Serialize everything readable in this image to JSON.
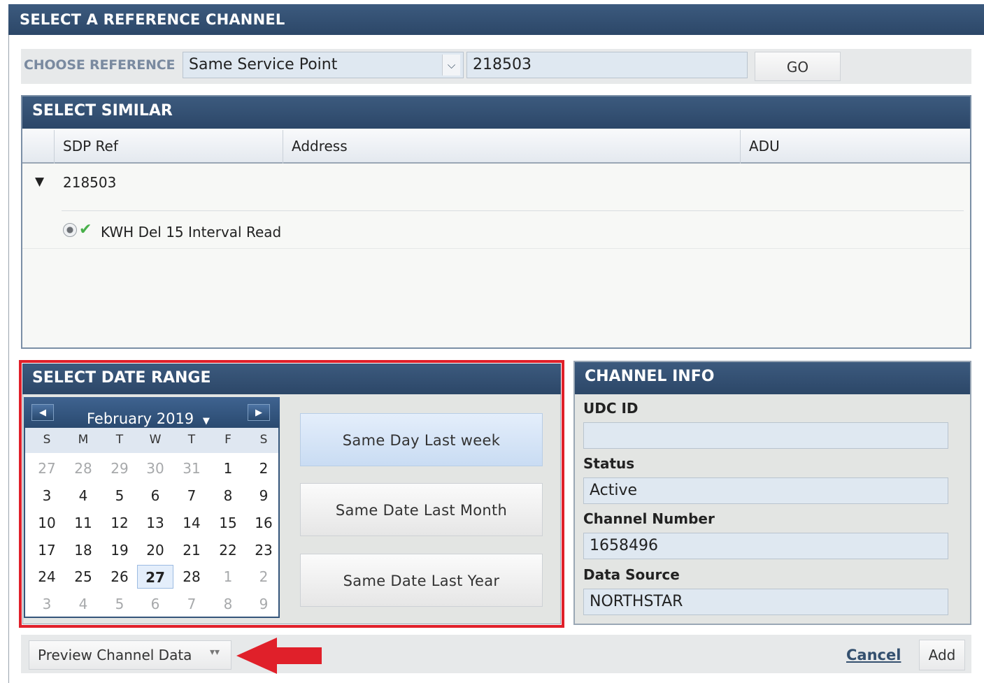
{
  "dialog": {
    "title": "SELECT A REFERENCE CHANNEL"
  },
  "choose": {
    "label": "CHOOSE REFERENCE",
    "selected": "Same Service Point",
    "reference_value": "218503",
    "go_label": "GO"
  },
  "similar": {
    "title": "SELECT SIMILAR",
    "columns": [
      "SDP Ref",
      "Address",
      "ADU"
    ],
    "sdp_ref": "218503",
    "channel_label": "KWH Del 15 Interval Read"
  },
  "date_range": {
    "title": "SELECT DATE RANGE",
    "month_label": "February 2019",
    "dow": [
      "S",
      "M",
      "T",
      "W",
      "T",
      "F",
      "S"
    ],
    "weeks": [
      [
        "27",
        "28",
        "29",
        "30",
        "31",
        "1",
        "2"
      ],
      [
        "3",
        "4",
        "5",
        "6",
        "7",
        "8",
        "9"
      ],
      [
        "10",
        "11",
        "12",
        "13",
        "14",
        "15",
        "16"
      ],
      [
        "17",
        "18",
        "19",
        "20",
        "21",
        "22",
        "23"
      ],
      [
        "24",
        "25",
        "26",
        "27",
        "28",
        "1",
        "2"
      ],
      [
        "3",
        "4",
        "5",
        "6",
        "7",
        "8",
        "9"
      ]
    ],
    "selected_day": "27",
    "buttons": {
      "same_day_last_week": "Same Day Last week",
      "same_date_last_month": "Same Date Last Month",
      "same_date_last_year": "Same Date Last Year"
    }
  },
  "channel_info": {
    "title": "CHANNEL INFO",
    "udc_id_label": "UDC ID",
    "udc_id_value": "",
    "status_label": "Status",
    "status_value": "Active",
    "channel_number_label": "Channel Number",
    "channel_number_value": "1658496",
    "data_source_label": "Data Source",
    "data_source_value": "NORTHSTAR"
  },
  "footer": {
    "preview_label": "Preview Channel Data",
    "cancel_label": "Cancel",
    "add_label": "Add"
  },
  "colors": {
    "header_navy": "#2c4768",
    "annotation_red": "#e0202a",
    "field_blue": "#dfe8f1"
  }
}
